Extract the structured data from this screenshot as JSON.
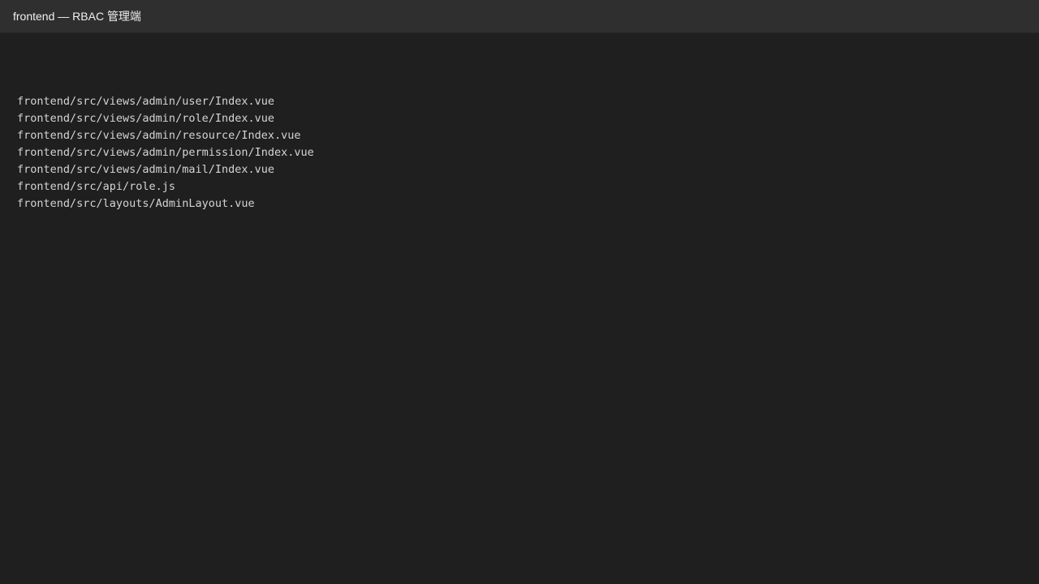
{
  "window": {
    "title": "frontend — RBAC 管理端"
  },
  "files": [
    "frontend/src/views/admin/user/Index.vue",
    "frontend/src/views/admin/role/Index.vue",
    "frontend/src/views/admin/resource/Index.vue",
    "frontend/src/views/admin/permission/Index.vue",
    "frontend/src/views/admin/mail/Index.vue",
    "frontend/src/api/role.js",
    "frontend/src/layouts/AdminLayout.vue"
  ],
  "colors": {
    "background": "#1f1f1f",
    "title_bar": "#2f2f2f",
    "text": "#d4d4d4",
    "title_text": "#f0f0f0"
  }
}
